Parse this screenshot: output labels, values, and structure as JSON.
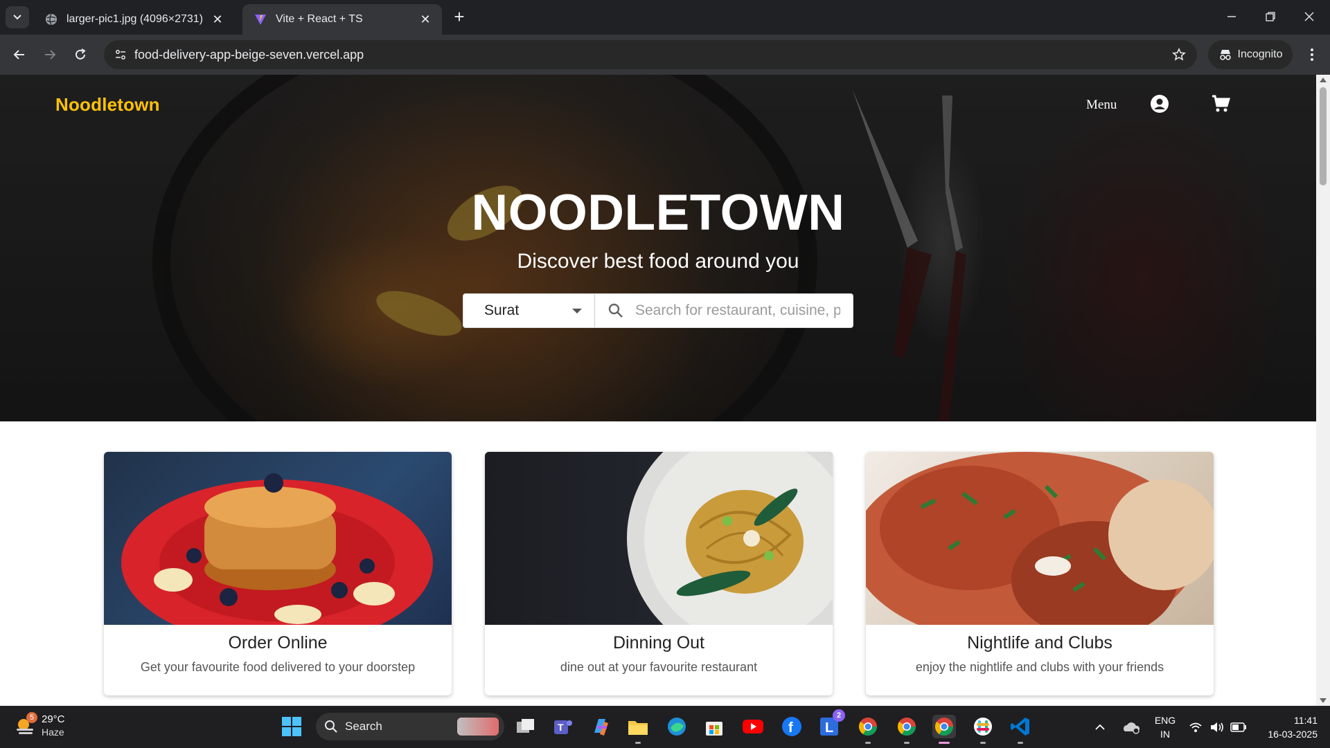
{
  "browser": {
    "tabs": [
      {
        "title": "larger-pic1.jpg (4096×2731)",
        "favicon": "globe-icon",
        "active": false
      },
      {
        "title": "Vite + React + TS",
        "favicon": "vite-icon",
        "active": true
      }
    ],
    "url": "food-delivery-app-beige-seven.vercel.app",
    "incognito_label": "Incognito"
  },
  "page": {
    "logo": "Noodletown",
    "nav": {
      "menu_label": "Menu"
    },
    "hero": {
      "title": "NOODLETOWN",
      "subtitle": "Discover best food around you",
      "city": "Surat",
      "search_placeholder": "Search for restaurant, cuisine, place"
    },
    "cards": [
      {
        "title": "Order Online",
        "desc": "Get your favourite food delivered to your doorstep"
      },
      {
        "title": "Dinning Out",
        "desc": "dine out at your favourite restaurant"
      },
      {
        "title": "Nightlife and Clubs",
        "desc": "enjoy the nightlife and clubs with your friends"
      }
    ],
    "colors": {
      "logo": "#ffc107",
      "hero_text": "#ffffff"
    }
  },
  "taskbar": {
    "weather": {
      "temp": "29°C",
      "condition": "Haze",
      "badge": "5"
    },
    "search_label": "Search",
    "language": {
      "line1": "ENG",
      "line2": "IN"
    },
    "clock": {
      "time": "11:41",
      "date": "16-03-2025"
    },
    "badges": {
      "lens": "2"
    }
  }
}
